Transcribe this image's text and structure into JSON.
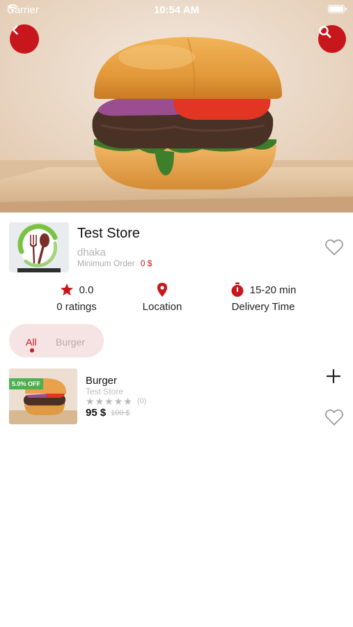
{
  "status_bar": {
    "carrier": "Carrier",
    "time": "10:54 AM"
  },
  "header": {
    "back_icon": "chevron-left-icon",
    "search_icon": "search-icon",
    "accent_color": "#c8161d"
  },
  "store": {
    "name": "Test Store",
    "city": "dhaka",
    "min_order_label": "Minimum Order",
    "min_order_value": "0 $",
    "favorite_icon": "heart-outline-icon"
  },
  "info": {
    "rating_value": "0.0",
    "rating_label": "0 ratings",
    "location_label": "Location",
    "delivery_time": "15-20 min",
    "delivery_label": "Delivery Time"
  },
  "tabs": [
    {
      "label": "All",
      "active": true
    },
    {
      "label": "Burger",
      "active": false
    }
  ],
  "products": [
    {
      "name": "Burger",
      "store": "Test Store",
      "discount": "5.0% OFF",
      "rating_count": "(0)",
      "stars": 0,
      "price": "95 $",
      "old_price": "100 $"
    }
  ],
  "colors": {
    "accent": "#c8161d",
    "discount_badge": "#4caf50",
    "tab_background": "#f6e4e4"
  }
}
